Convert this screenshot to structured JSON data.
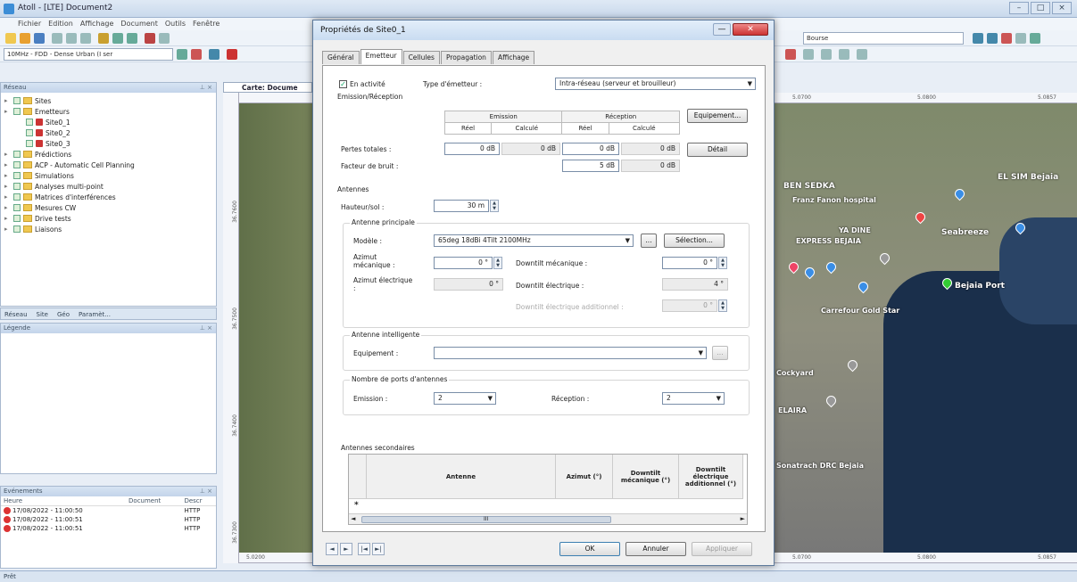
{
  "window": {
    "title": "Atoll - [LTE] Document2"
  },
  "menu": [
    "Fichier",
    "Edition",
    "Affichage",
    "Document",
    "Outils",
    "Fenêtre"
  ],
  "toolbar": {
    "tech_combo": "10MHz - FDD - Dense Urban (I ser",
    "search_combo": "Bourse"
  },
  "explorer": {
    "header": "Réseau",
    "items": [
      {
        "label": "Sites",
        "level": 0,
        "kind": "folder"
      },
      {
        "label": "Emetteurs",
        "level": 0,
        "kind": "folder"
      },
      {
        "label": "Site0_1",
        "level": 1,
        "kind": "site"
      },
      {
        "label": "Site0_2",
        "level": 1,
        "kind": "site"
      },
      {
        "label": "Site0_3",
        "level": 1,
        "kind": "site"
      },
      {
        "label": "Prédictions",
        "level": 0,
        "kind": "folder"
      },
      {
        "label": "ACP - Automatic Cell Planning",
        "level": 0,
        "kind": "folder"
      },
      {
        "label": "Simulations",
        "level": 0,
        "kind": "folder"
      },
      {
        "label": "Analyses multi-point",
        "level": 0,
        "kind": "folder"
      },
      {
        "label": "Matrices d'interférences",
        "level": 0,
        "kind": "folder"
      },
      {
        "label": "Mesures CW",
        "level": 0,
        "kind": "folder"
      },
      {
        "label": "Drive tests",
        "level": 0,
        "kind": "folder"
      },
      {
        "label": "Liaisons",
        "level": 0,
        "kind": "folder"
      }
    ],
    "tabs": [
      "Réseau",
      "Site",
      "Géo",
      "Paramèt..."
    ]
  },
  "legend": {
    "header": "Légende"
  },
  "events": {
    "header": "Evénements",
    "columns": [
      "Heure",
      "Document",
      "Descr"
    ],
    "rows": [
      {
        "time": "17/08/2022 - 11:00:50",
        "desc": "HTTP"
      },
      {
        "time": "17/08/2022 - 11:00:51",
        "desc": "HTTP"
      },
      {
        "time": "17/08/2022 - 11:00:51",
        "desc": "HTTP"
      }
    ]
  },
  "status": {
    "text": "Prêt"
  },
  "map": {
    "tab_label": "Carte: Docume",
    "labels": [
      "BEN SEDKA",
      "Franz Fanon hospital",
      "EL SIM Bejaia",
      "YA DINE",
      "EXPRESS BEJAIA",
      "Seabreeze",
      "Bejaia Port",
      "Carrefour Gold Star",
      "Cockyard",
      "ELAIRA",
      "Sonatrach DRC Bejaia"
    ],
    "ruler_top": [
      "5.0700",
      "5.0800",
      "5.0857"
    ],
    "ruler_bottom": [
      "5.0200",
      "5.0700",
      "5.0800",
      "5.0857"
    ],
    "ruler_left": [
      "36.7600",
      "36.7500",
      "36.7400",
      "36.7300"
    ]
  },
  "dialog": {
    "title": "Propriétés de Site0_1",
    "min_label": "—",
    "close_label": "✕",
    "tabs": [
      "Général",
      "Emetteur",
      "Cellules",
      "Propagation",
      "Affichage"
    ],
    "active_tab": "Emetteur",
    "en_activite": "En activité",
    "type_label": "Type d'émetteur :",
    "type_value": "Intra-réseau (serveur et brouilleur)",
    "emission_reception": {
      "title": "Emission/Réception",
      "col_emission": "Emission",
      "col_reception": "Réception",
      "sub_reel": "Réel",
      "sub_calcule": "Calculé",
      "equipement_btn": "Equipement...",
      "pertes_label": "Pertes totales :",
      "pertes": [
        "0 dB",
        "0 dB",
        "0 dB",
        "0 dB"
      ],
      "detail_btn": "Détail",
      "bruit_label": "Facteur de bruit :",
      "bruit": [
        "5 dB",
        "0 dB"
      ]
    },
    "antennes": {
      "title": "Antennes",
      "hauteur_label": "Hauteur/sol :",
      "hauteur_value": "30 m",
      "principale_title": "Antenne principale",
      "modele_label": "Modèle :",
      "modele_value": "65deg 18dBi 4Tilt 2100MHz",
      "browse_btn": "...",
      "selection_btn": "Sélection...",
      "azimut_mec_label": "Azimut mécanique :",
      "azimut_mec_value": "0 °",
      "downtilt_mec_label": "Downtilt mécanique :",
      "downtilt_mec_value": "0 °",
      "azimut_elec_label": "Azimut électrique :",
      "azimut_elec_value": "0 °",
      "downtilt_elec_label": "Downtilt électrique :",
      "downtilt_elec_value": "4 °",
      "downtilt_add_label": "Downtilt électrique additionnel :",
      "downtilt_add_value": "0 °"
    },
    "intelligente": {
      "title": "Antenne intelligente",
      "equip_label": "Equipement :",
      "equip_value": "",
      "browse_btn": "..."
    },
    "ports": {
      "title": "Nombre de ports d'antennes",
      "emission_label": "Emission :",
      "emission_value": "2",
      "reception_label": "Réception :",
      "reception_value": "2"
    },
    "secondaires": {
      "title": "Antennes secondaires",
      "columns": [
        "Antenne",
        "Azimut (°)",
        "Downtilt mécanique (°)",
        "Downtilt électrique additionnel (°)"
      ],
      "new_row_marker": "*",
      "scroll_marker": "III"
    },
    "buttons": {
      "ok": "OK",
      "cancel": "Annuler",
      "apply": "Appliquer"
    },
    "nav": [
      "◄",
      "►",
      "|◄",
      "►|"
    ]
  }
}
